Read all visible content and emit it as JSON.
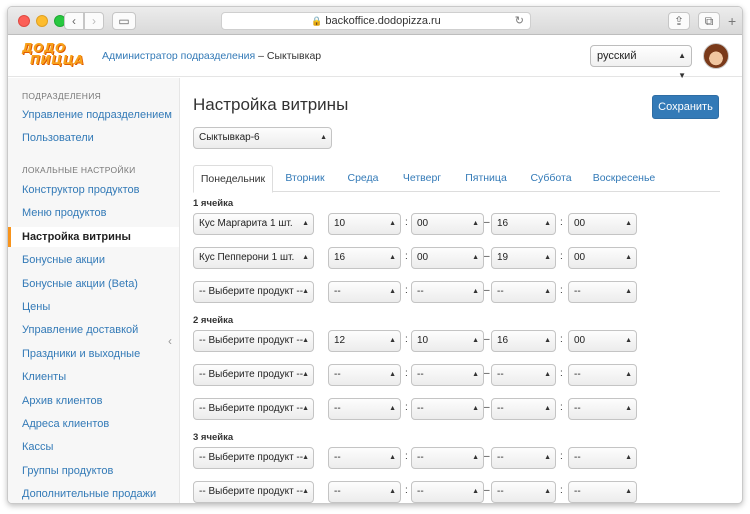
{
  "browser": {
    "url": "backoffice.dodopizza.ru"
  },
  "header": {
    "logo_line1": "ДОДО",
    "logo_line2": "ПИЦЦА",
    "role_link": "Администратор подразделения",
    "role_suffix": " – Сыктывкар",
    "language": "русский"
  },
  "sidebar": {
    "section1": "ПОДРАЗДЕЛЕНИЯ",
    "section1_items": [
      "Управление подразделением",
      "Пользователи"
    ],
    "section2": "ЛОКАЛЬНЫЕ НАСТРОЙКИ",
    "section2_items": [
      "Конструктор продуктов",
      "Меню продуктов",
      "Настройка витрины",
      "Бонусные акции",
      "Бонусные акции (Beta)",
      "Цены",
      "Управление доставкой",
      "Праздники и выходные",
      "Клиенты",
      "Архив клиентов",
      "Адреса клиентов",
      "Кассы",
      "Группы продуктов",
      "Дополнительные продажи"
    ],
    "active_item": "Настройка витрины"
  },
  "main": {
    "title": "Настройка витрины",
    "save_label": "Сохранить",
    "unit": "Сыктывкар-6",
    "tabs": [
      "Понедельник",
      "Вторник",
      "Среда",
      "Четверг",
      "Пятница",
      "Суббота",
      "Воскресенье"
    ],
    "active_tab": "Понедельник",
    "cells": [
      {
        "label": "1 ячейка",
        "rows": [
          {
            "product": "Кус Маргарита 1 шт.",
            "from_h": "10",
            "from_m": "00",
            "to_h": "16",
            "to_m": "00"
          },
          {
            "product": "Кус Пепперони 1 шт.",
            "from_h": "16",
            "from_m": "00",
            "to_h": "19",
            "to_m": "00"
          },
          {
            "product": "-- Выберите продукт --",
            "from_h": "--",
            "from_m": "--",
            "to_h": "--",
            "to_m": "--"
          }
        ]
      },
      {
        "label": "2 ячейка",
        "rows": [
          {
            "product": "-- Выберите продукт --",
            "from_h": "12",
            "from_m": "10",
            "to_h": "16",
            "to_m": "00"
          },
          {
            "product": "-- Выберите продукт --",
            "from_h": "--",
            "from_m": "--",
            "to_h": "--",
            "to_m": "--"
          },
          {
            "product": "-- Выберите продукт --",
            "from_h": "--",
            "from_m": "--",
            "to_h": "--",
            "to_m": "--"
          }
        ]
      },
      {
        "label": "3 ячейка",
        "rows": [
          {
            "product": "-- Выберите продукт --",
            "from_h": "--",
            "from_m": "--",
            "to_h": "--",
            "to_m": "--"
          },
          {
            "product": "-- Выберите продукт --",
            "from_h": "--",
            "from_m": "--",
            "to_h": "--",
            "to_m": "--"
          }
        ]
      }
    ],
    "time_sep": ":",
    "range_sep": "–"
  },
  "colors": {
    "link": "#337ab7",
    "primary_button": "#337ab7",
    "active_marker": "#f7941d",
    "logo": "#f7a11a"
  },
  "icons": [
    "back-icon",
    "forward-icon",
    "sidebar-icon",
    "lock-icon",
    "reload-icon",
    "share-icon",
    "tabs-icon",
    "plus-icon",
    "select-arrows-icon",
    "collapse-chevron-icon"
  ]
}
